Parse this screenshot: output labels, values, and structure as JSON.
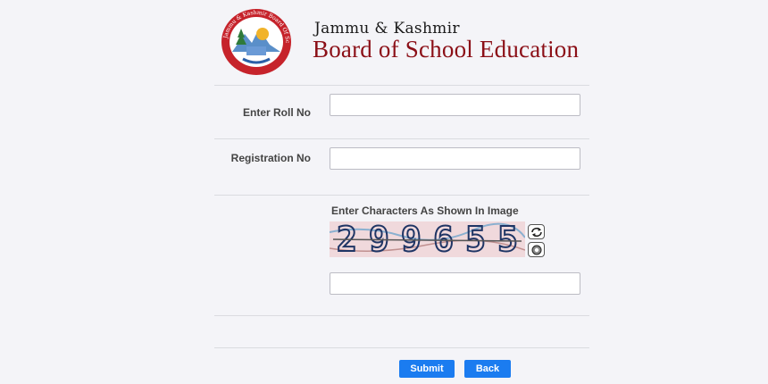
{
  "header": {
    "org_subtitle": "Jammu & Kashmir",
    "org_title": "Board of School Education",
    "logo_text": "Jammu & Kashmir Board Of School Education"
  },
  "form": {
    "roll_label": "Enter Roll No",
    "roll_value": "",
    "registration_label": "Registration No",
    "registration_value": "",
    "captcha_title": "Enter Characters As Shown In Image",
    "captcha_text": "299655",
    "captcha_value": ""
  },
  "buttons": {
    "submit_label": "Submit",
    "back_label": "Back"
  },
  "icons": {
    "refresh": "refresh-icon",
    "audio": "audio-icon"
  },
  "colors": {
    "brand_red": "#8b0f17",
    "button_blue": "#1b7cf0"
  }
}
